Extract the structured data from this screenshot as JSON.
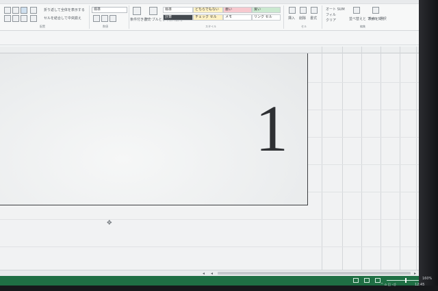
{
  "ribbon": {
    "wrap_text": "折り返して全体を表示する",
    "merge_center": "セルを結合して中央揃え",
    "number_format": "標準",
    "groups": {
      "alignment": "配置",
      "number": "数値",
      "styles": "スタイル",
      "cells": "セル",
      "editing": "編集"
    },
    "conditional_format": "条件付き書式",
    "format_as_table": "テーブルとして書式設定",
    "styles": [
      "標準",
      "どちらでもない",
      "悪い",
      "良い",
      "計算",
      "チェック セル",
      "メモ",
      "リンク セル"
    ],
    "insert": "挿入",
    "delete": "削除",
    "format": "書式",
    "autosum": "オート SUM",
    "fill": "フィル",
    "clear": "クリア",
    "sort_filter": "並べ替えと フィルター",
    "find_select": "検索と 選択"
  },
  "sheet": {
    "merged_cell_value": "1"
  },
  "status": {
    "zoom": "160%"
  },
  "taskbar": {
    "time": "12:45"
  },
  "colors": {
    "statusbar": "#1f6f44",
    "style_neutral": "#fff2c4",
    "style_bad": "#f7c9cf",
    "style_good": "#cbe9d0",
    "style_calc": "#444a50"
  }
}
